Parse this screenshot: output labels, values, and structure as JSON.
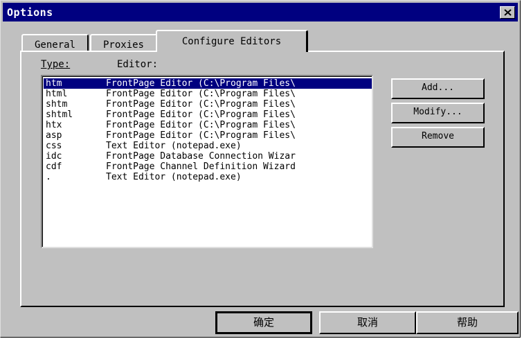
{
  "window": {
    "title": "Options"
  },
  "tabs": [
    {
      "label": "General"
    },
    {
      "label": "Proxies"
    },
    {
      "label": "Configure Editors"
    }
  ],
  "list": {
    "header_type": "Type:",
    "header_editor": "Editor:",
    "rows": [
      {
        "type": "htm",
        "editor": "FrontPage Editor (C:\\Program Files\\"
      },
      {
        "type": "html",
        "editor": "FrontPage Editor (C:\\Program Files\\"
      },
      {
        "type": "shtm",
        "editor": "FrontPage Editor (C:\\Program Files\\"
      },
      {
        "type": "shtml",
        "editor": "FrontPage Editor (C:\\Program Files\\"
      },
      {
        "type": "htx",
        "editor": "FrontPage Editor (C:\\Program Files\\"
      },
      {
        "type": "asp",
        "editor": "FrontPage Editor (C:\\Program Files\\"
      },
      {
        "type": "css",
        "editor": "Text Editor (notepad.exe)"
      },
      {
        "type": "idc",
        "editor": "FrontPage Database Connection Wizar"
      },
      {
        "type": "cdf",
        "editor": "FrontPage Channel Definition Wizard"
      },
      {
        "type": ".",
        "editor": "Text Editor (notepad.exe)"
      }
    ],
    "selected_index": 0
  },
  "buttons": {
    "add": "Add...",
    "modify": "Modify...",
    "remove": "Remove",
    "ok": "确定",
    "cancel": "取消",
    "help": "帮助"
  },
  "colors": {
    "titlebar": "#000080",
    "face": "#c0c0c0",
    "selection": "#000080"
  }
}
